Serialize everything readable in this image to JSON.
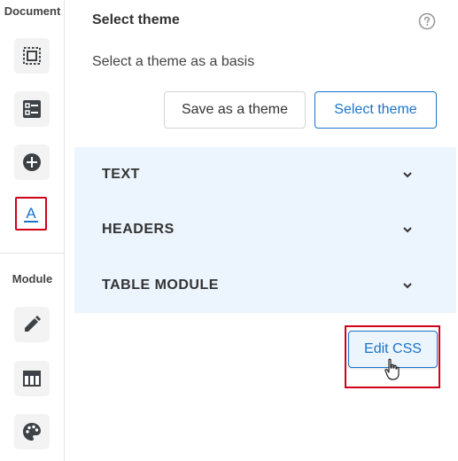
{
  "toolbar": {
    "document_label": "Document",
    "module_label": "Module",
    "document_tools": [
      {
        "icon": "select-area-icon"
      },
      {
        "icon": "layout-list-icon"
      },
      {
        "icon": "add-circle-icon"
      },
      {
        "icon": "text-style-icon",
        "active": true
      }
    ],
    "module_tools": [
      {
        "icon": "pencil-icon"
      },
      {
        "icon": "table-layout-icon"
      },
      {
        "icon": "palette-icon"
      }
    ]
  },
  "panel": {
    "title": "Select theme",
    "subtitle": "Select a theme as a basis",
    "help_icon": "help-circle-icon",
    "save_theme_label": "Save as a theme",
    "select_theme_label": "Select theme",
    "sections": [
      {
        "label": "TEXT",
        "icon": "chevron-down-icon"
      },
      {
        "label": "HEADERS",
        "icon": "chevron-down-icon"
      },
      {
        "label": "TABLE MODULE",
        "icon": "chevron-down-icon"
      }
    ],
    "edit_css_label": "Edit CSS"
  },
  "colors": {
    "accent": "#1b74c9",
    "highlight": "#d0021b",
    "accordion_bg": "#ecf4fd",
    "icon_dark": "#3d4247"
  }
}
